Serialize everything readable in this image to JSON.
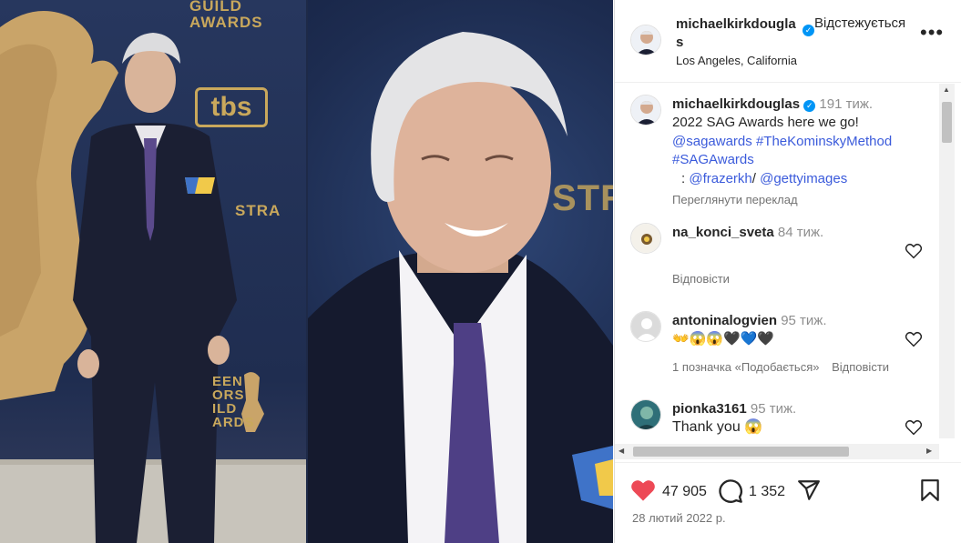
{
  "post": {
    "username": "michaelkirkdouglas",
    "follow_label": "Відстежується",
    "location": "Los Angeles, California",
    "more_label": "•••"
  },
  "photo": {
    "sag_top": "GUILD\nAWARDS",
    "tbs": "tbs",
    "stra": "STRA",
    "sag_bottom": "EEN\nORS\nILD\nARDS",
    "stra_right": "STRA"
  },
  "caption": {
    "username": "michaelkirkdouglas",
    "time": "191 тиж.",
    "text": "2022 SAG Awards here we go!",
    "link1": "@sagawards",
    "link2": "#TheKominskyMethod",
    "link3": "#SAGAwards",
    "credit_prefix": ":",
    "credit1": "@frazerkh",
    "credit_sep": "/",
    "credit2": "@gettyimages",
    "translate": "Переглянути переклад"
  },
  "comments": [
    {
      "username": "na_konci_sveta",
      "time": "84 тиж.",
      "text": "",
      "reply": "Відповісти",
      "likes": ""
    },
    {
      "username": "antoninalogvien",
      "time": "95 тиж.",
      "text": "👐😱😱🖤💙🖤",
      "reply": "Відповісти",
      "likes": "1 позначка «Подобається»"
    },
    {
      "username": "pionka3161",
      "time": "95 тиж.",
      "text": "Thank you 😱",
      "reply": "",
      "likes": ""
    }
  ],
  "stats": {
    "likes": "47 905",
    "comments": "1 352",
    "date": "28 лютий 2022 р."
  },
  "colors": {
    "like_red": "#ed4956",
    "link_blue": "#3b5bdb",
    "verified_blue": "#0095f6"
  }
}
